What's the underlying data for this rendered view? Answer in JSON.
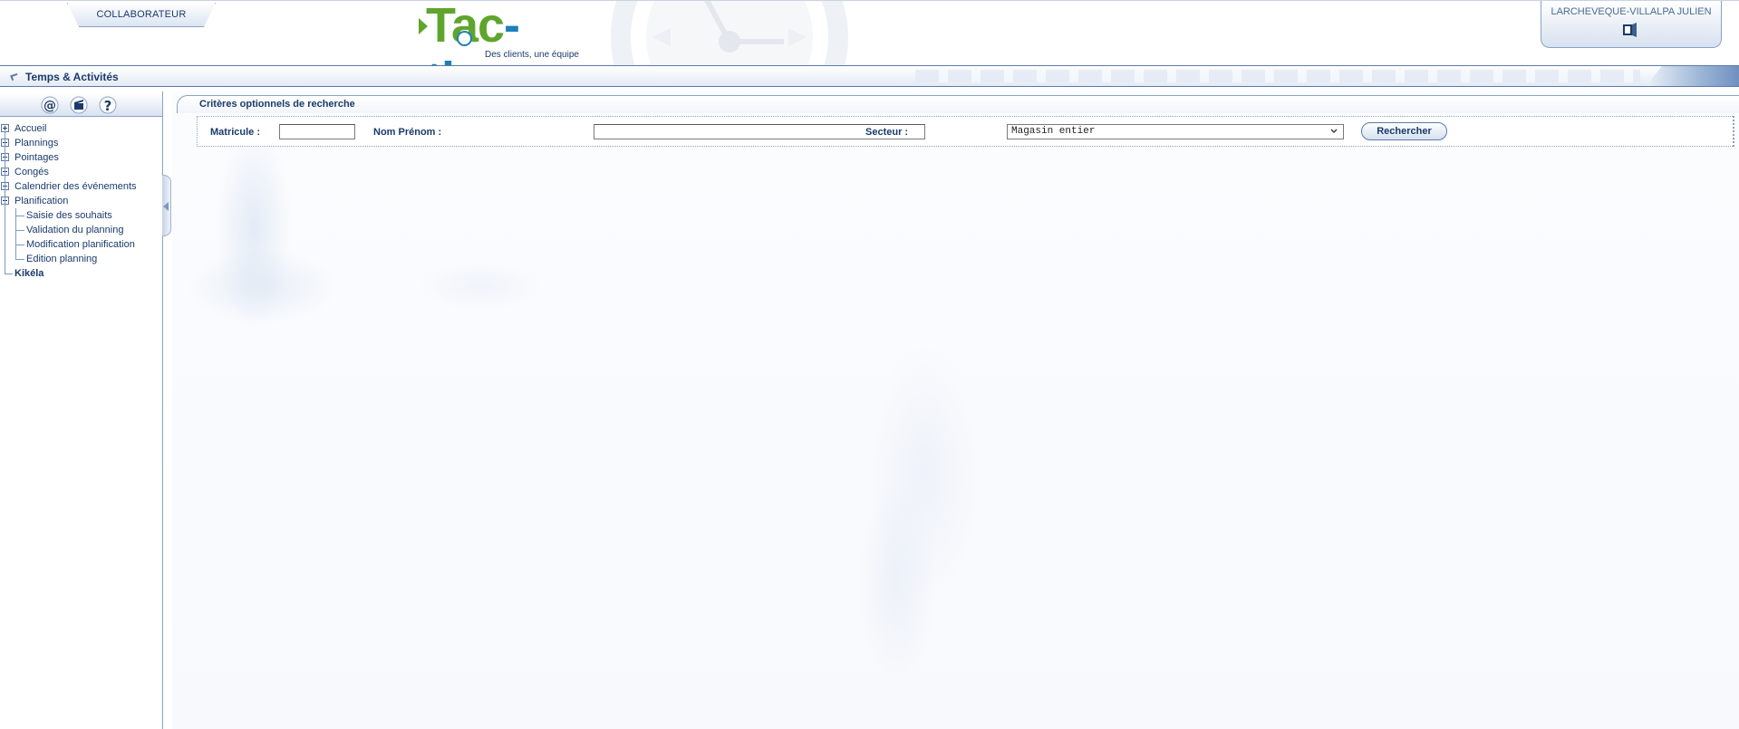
{
  "header": {
    "role_tab": "COLLABORATEUR",
    "logo": {
      "text_green": "Tac",
      "text_blue": "-tic",
      "tagline": "Des clients, une équipe"
    },
    "user": {
      "name": "LARCHEVEQUE-VILLALPA JULIEN",
      "logout_icon": "door-exit-icon"
    }
  },
  "titlebar": {
    "title": "Temps & Activités"
  },
  "sidebar": {
    "toolbar": [
      {
        "icon": "at-sign-icon",
        "glyph": "@"
      },
      {
        "icon": "clapperboard-icon"
      },
      {
        "icon": "help-icon",
        "glyph": "?"
      }
    ],
    "tree": [
      {
        "label": "Accueil",
        "expanded": false
      },
      {
        "label": "Plannings",
        "expanded": false
      },
      {
        "label": "Pointages",
        "expanded": false
      },
      {
        "label": "Congés",
        "expanded": false
      },
      {
        "label": "Calendrier des événements",
        "expanded": false
      },
      {
        "label": "Planification",
        "expanded": true,
        "children": [
          "Saisie des souhaits",
          "Validation du planning",
          "Modification planification",
          "Edition planning"
        ]
      },
      {
        "label": "Kikéla",
        "bold": true
      }
    ]
  },
  "main": {
    "section_title": "Critères optionnels de recherche",
    "criteria": {
      "matricule_label": "Matricule :",
      "matricule_value": "",
      "nom_label": "Nom Prénom :",
      "nom_value": "",
      "secteur_label": "Secteur :",
      "secteur_selected": "Magasin entier",
      "search_button": "Rechercher"
    }
  },
  "colors": {
    "navy": "#1a3a6b",
    "border": "#8ba1c4",
    "green": "#5fa52d",
    "blue": "#1f7fb8"
  }
}
